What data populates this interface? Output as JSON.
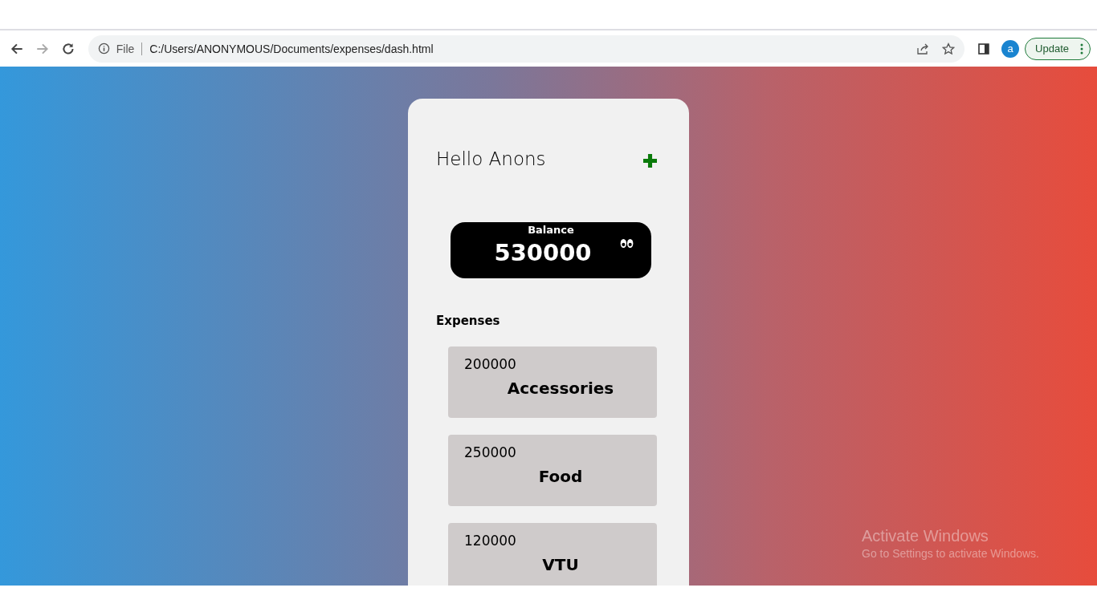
{
  "browser": {
    "scheme": "File",
    "address": "C:/Users/ANONYMOUS/Documents/expenses/dash.html",
    "profile_initial": "a",
    "update_label": "Update"
  },
  "header": {
    "greeting": "Hello Anons"
  },
  "balance": {
    "label": "Balance",
    "amount": "530000"
  },
  "expenses": {
    "title": "Expenses",
    "items": [
      {
        "amount": "200000",
        "category": "Accessories"
      },
      {
        "amount": "250000",
        "category": "Food"
      },
      {
        "amount": "120000",
        "category": "VTU"
      }
    ]
  },
  "os_notice": {
    "title": "Activate Windows",
    "message": "Go to Settings to activate Windows."
  }
}
